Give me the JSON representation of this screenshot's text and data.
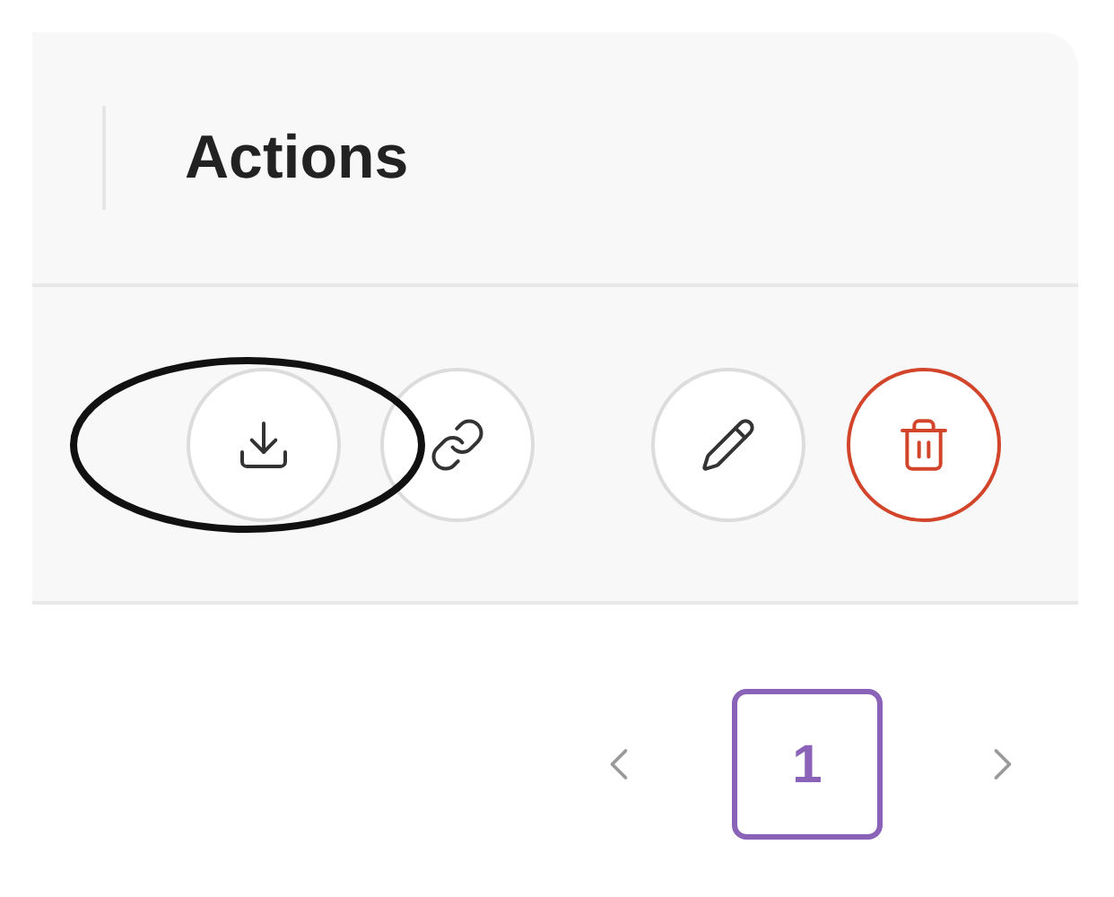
{
  "header": {
    "title": "Actions"
  },
  "actions": [
    {
      "kind": "download",
      "circled": true
    },
    {
      "kind": "link",
      "circled": false
    },
    {
      "kind": "edit",
      "circled": false
    },
    {
      "kind": "delete",
      "circled": false
    }
  ],
  "pagination": {
    "pages": [
      {
        "label": "1",
        "selected": true
      }
    ]
  }
}
